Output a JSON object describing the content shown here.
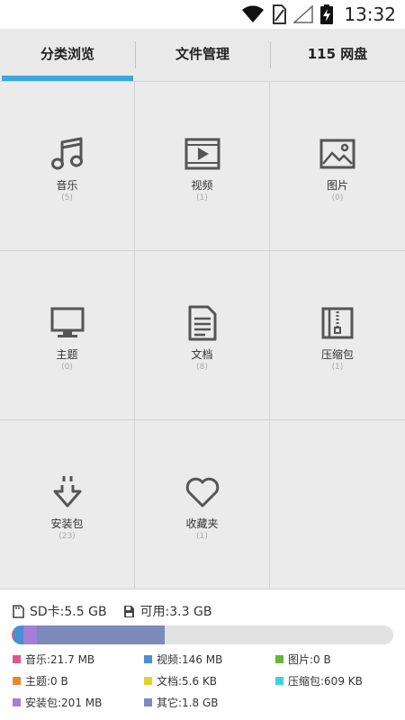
{
  "status": {
    "time": "13:32"
  },
  "tabs": [
    {
      "label": "分类浏览",
      "active": true
    },
    {
      "label": "文件管理",
      "active": false
    },
    {
      "label": "115 网盘",
      "active": false
    }
  ],
  "categories": [
    {
      "label": "音乐",
      "count": "(5)",
      "icon": "music-icon"
    },
    {
      "label": "视频",
      "count": "(1)",
      "icon": "video-icon"
    },
    {
      "label": "图片",
      "count": "(0)",
      "icon": "image-icon"
    },
    {
      "label": "主题",
      "count": "(0)",
      "icon": "monitor-icon"
    },
    {
      "label": "文档",
      "count": "(8)",
      "icon": "document-icon"
    },
    {
      "label": "压缩包",
      "count": "(1)",
      "icon": "archive-icon"
    },
    {
      "label": "安装包",
      "count": "(23)",
      "icon": "download-icon"
    },
    {
      "label": "收藏夹",
      "count": "(1)",
      "icon": "heart-icon"
    }
  ],
  "storage": {
    "sd_label": "SD卡:5.5 GB",
    "available_label": "可用:3.3 GB",
    "usage_fraction": 0.4,
    "segments": [
      {
        "name": "music",
        "fraction": 0.004,
        "color": "#e0578a"
      },
      {
        "name": "video",
        "fraction": 0.026,
        "color": "#4a8fd0"
      },
      {
        "name": "apk",
        "fraction": 0.035,
        "color": "#a37fd6"
      },
      {
        "name": "other",
        "fraction": 0.335,
        "color": "#7d8aba"
      }
    ],
    "legend": [
      {
        "label": "音乐:21.7 MB",
        "color": "#e0578a"
      },
      {
        "label": "视频:146 MB",
        "color": "#4a8fd0"
      },
      {
        "label": "图片:0 B",
        "color": "#67b53d"
      },
      {
        "label": "主题:0 B",
        "color": "#e8892a"
      },
      {
        "label": "文档:5.6 KB",
        "color": "#e6cf2e"
      },
      {
        "label": "压缩包:609 KB",
        "color": "#3fd3d8"
      },
      {
        "label": "安装包:201 MB",
        "color": "#a37fd6"
      },
      {
        "label": "其它:1.8 GB",
        "color": "#7d8aba"
      }
    ]
  }
}
